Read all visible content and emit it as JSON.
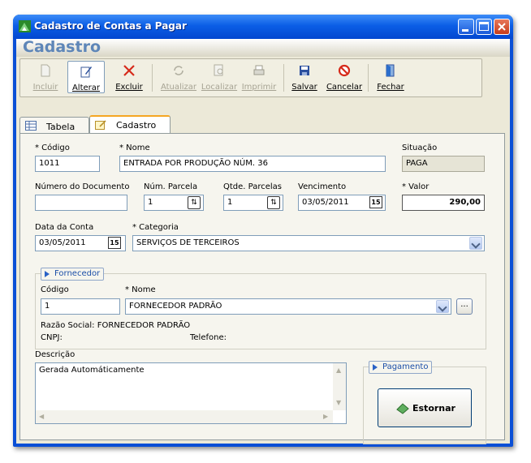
{
  "window": {
    "title": "Cadastro de Contas a Pagar"
  },
  "header": {
    "title": "Cadastro"
  },
  "toolbar": {
    "incluir": "Incluir",
    "alterar": "Alterar",
    "excluir": "Excluir",
    "atualizar": "Atualizar",
    "localizar": "Localizar",
    "imprimir": "Imprimir",
    "salvar": "Salvar",
    "cancelar": "Cancelar",
    "fechar": "Fechar"
  },
  "tabs": {
    "tabela": "Tabela",
    "cadastro": "Cadastro"
  },
  "form": {
    "codigo_label": "* Código",
    "codigo_value": "1011",
    "nome_label": "* Nome",
    "nome_value": "ENTRADA POR PRODUÇÃO NÚM. 36",
    "situacao_label": "Situação",
    "situacao_value": "PAGA",
    "numdoc_label": "Número do Documento",
    "numdoc_value": "",
    "num_parcela_label": "Núm. Parcela",
    "num_parcela_value": "1",
    "qtde_parcelas_label": "Qtde. Parcelas",
    "qtde_parcelas_value": "1",
    "vencimento_label": "Vencimento",
    "vencimento_value": "03/05/2011",
    "valor_label": "* Valor",
    "valor_value": "290,00",
    "data_conta_label": "Data da Conta",
    "data_conta_value": "03/05/2011",
    "categoria_label": "* Categoria",
    "categoria_value": "SERVIÇOS DE TERCEIROS",
    "calendar_glyph": "15"
  },
  "fornecedor": {
    "legend": "Fornecedor",
    "codigo_label": "Código",
    "codigo_value": "1",
    "nome_label": "* Nome",
    "nome_value": "FORNECEDOR PADRÃO",
    "browse_label": "...",
    "razao_social": "Razão Social: FORNECEDOR PADRÃO",
    "cnpj": "CNPJ:",
    "telefone": "Telefone:"
  },
  "descricao": {
    "label": "Descrição",
    "value": "Gerada Automáticamente"
  },
  "pagamento": {
    "legend": "Pagamento",
    "button": "Estornar"
  },
  "colors": {
    "accent": "#0a4fd6",
    "header_text": "#5e86b8",
    "tab_highlight": "#f5a623"
  }
}
